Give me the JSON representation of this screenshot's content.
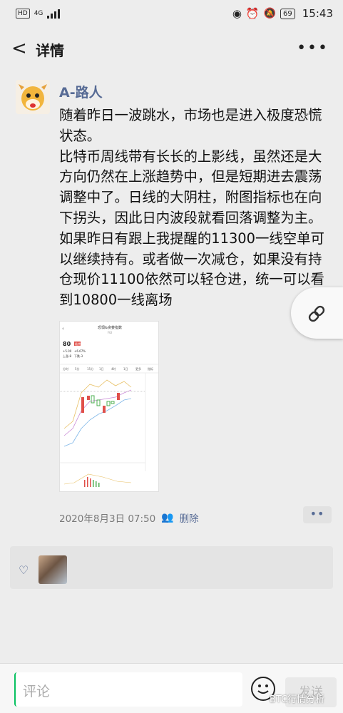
{
  "status": {
    "hd": "HD",
    "net": "4G",
    "battery": "69",
    "time": "15:43"
  },
  "nav": {
    "back": "<",
    "title": "详情",
    "more": "•••"
  },
  "post": {
    "author": "A-路人",
    "text": "随着昨日一波跳水，市场也是进入极度恐慌状态。\n比特币周线带有长长的上影线，虽然还是大方向仍然在上涨趋势中，但是短期进去震荡调整中了。日线的大阴柱，附图指标也在向下拐头，因此日内波段就看回落调整为主。\n如果昨日有跟上我提醒的11300一线空单可以继续持有。或者做一次减仓，如果没有持仓现价11100依然可以轻仓进，统一可以看到10800一线离场",
    "thumb": {
      "title": "恐惧&贪婪指数",
      "sub": "FGI",
      "value": "80",
      "value_tag": "极贪",
      "chg1": "+5.00",
      "chg2": "+6.67%",
      "up": "上涨-8",
      "down": "下跌-3",
      "tabs": [
        "分时",
        "5分",
        "15分",
        "1日",
        "4时",
        "1日",
        "更多",
        "指标"
      ]
    },
    "date": "2020年8月3日 07:50",
    "delete": "删除",
    "menu_dots": "••"
  },
  "likes": {
    "heart": "♡"
  },
  "comment": {
    "placeholder": "评论",
    "send": "发送"
  },
  "watermark": "BTC行情分析"
}
